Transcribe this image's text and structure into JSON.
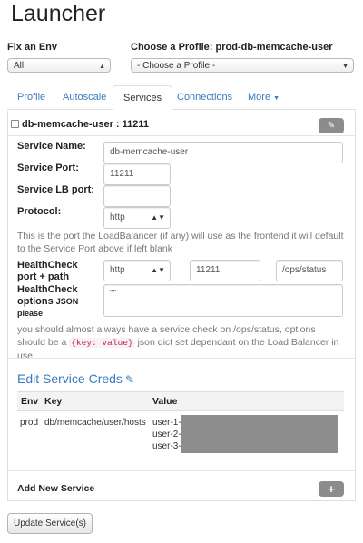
{
  "title": "Launcher",
  "env": {
    "label": "Fix an Env",
    "selected": "All"
  },
  "profile": {
    "label": "Choose a Profile: prod-db-memcache-user",
    "selected": "- Choose a Profile -"
  },
  "tabs": [
    {
      "label": "Profile"
    },
    {
      "label": "Autoscale"
    },
    {
      "label": "Services"
    },
    {
      "label": "Connections"
    },
    {
      "label": "More"
    }
  ],
  "service": {
    "header": "db-memcache-user : 11211",
    "name_label": "Service Name:",
    "name_value": "db-memcache-user",
    "port_label": "Service Port:",
    "port_value": "11211",
    "lb_port_label": "Service LB port:",
    "lb_port_value": "",
    "protocol_label": "Protocol:",
    "protocol_value": "http",
    "lb_help": "This is the port the LoadBalancer (if any) will use as the frontend it will default to the Service Port above if left blank",
    "healthcheck_label_1": "HealthCheck",
    "healthcheck_label_2": "port + path",
    "hc_protocol": "http",
    "hc_port": "11211",
    "hc_path": "/ops/status",
    "hc_options_label_1": "HealthCheck",
    "hc_options_label_2": "options",
    "hc_options_label_json": "JSON",
    "hc_options_label_3": "please",
    "hc_options_value": "\"\"",
    "hc_help_1": "you should almost always have a service check on /ops/status, options should be a",
    "hc_help_code": "{key: value}",
    "hc_help_2": "json dict set dependant on the Load Balancer in use"
  },
  "creds": {
    "title": "Edit Service Creds",
    "columns": [
      "Env",
      "Key",
      "Value"
    ],
    "rows": [
      {
        "env": "prod",
        "key": "db/memcache/user/hosts",
        "values": [
          "user-1-",
          "user-2-",
          "user-3-"
        ]
      }
    ]
  },
  "add_service_label": "Add New Service",
  "add_service_button": "+",
  "update_button": "Update Service(s)",
  "icons": {
    "edit": "pencil-icon",
    "add": "plus-icon",
    "dropdown": "caret-down-icon"
  },
  "colors": {
    "link": "#3a7bbf",
    "code": "#c7254e",
    "button_gray": "#8c8c8c"
  }
}
